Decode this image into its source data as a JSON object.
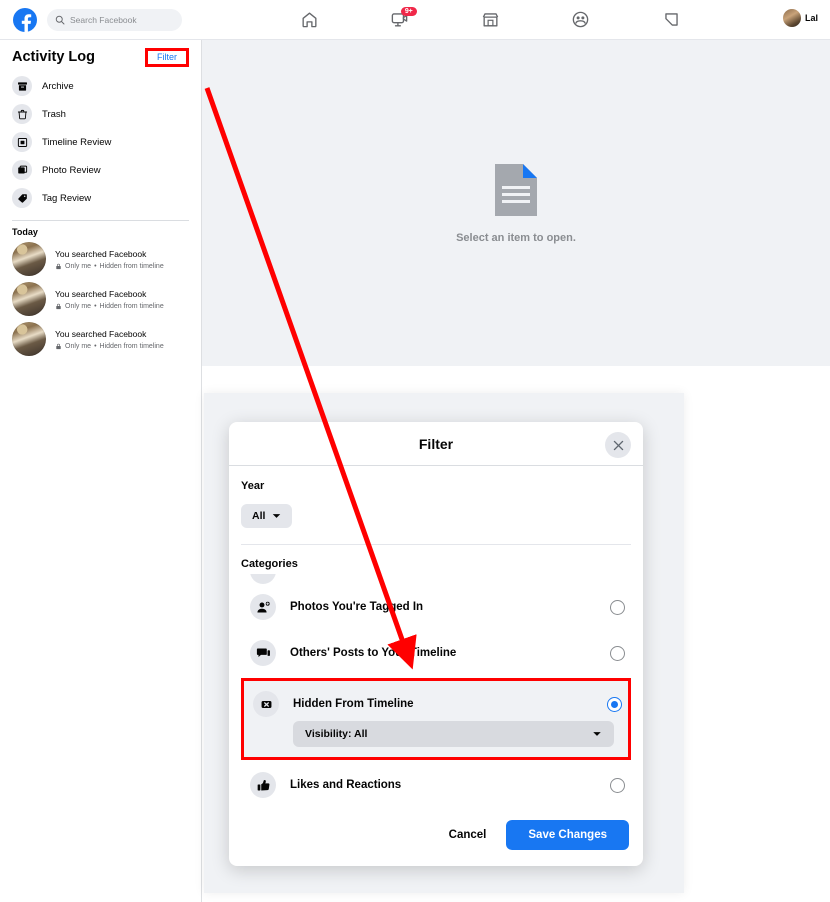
{
  "topbar": {
    "logo_icon": "facebook-logo-icon",
    "search": {
      "placeholder": "Search Facebook",
      "value": "",
      "icon": "search-icon"
    },
    "nav": [
      {
        "name": "home",
        "icon": "home-icon",
        "badge": ""
      },
      {
        "name": "watch",
        "icon": "video-watch-icon",
        "badge": "9+"
      },
      {
        "name": "marketplace",
        "icon": "marketplace-store-icon",
        "badge": ""
      },
      {
        "name": "groups",
        "icon": "groups-icon",
        "badge": ""
      },
      {
        "name": "gaming",
        "icon": "gaming-icon",
        "badge": ""
      }
    ],
    "profile": {
      "name": "Lal",
      "avatar_icon": "avatar"
    }
  },
  "sidebar": {
    "title": "Activity Log",
    "filter_label": "Filter",
    "items": [
      {
        "label": "Archive",
        "icon": "archive-box-icon"
      },
      {
        "label": "Trash",
        "icon": "trash-can-icon"
      },
      {
        "label": "Timeline Review",
        "icon": "timeline-review-icon"
      },
      {
        "label": "Photo Review",
        "icon": "photo-review-icon"
      },
      {
        "label": "Tag Review",
        "icon": "tag-icon"
      }
    ],
    "section_label": "Today",
    "activities": [
      {
        "title": "You searched Facebook",
        "privacy": "Only me",
        "separator": "•",
        "visibility": "Hidden from timeline",
        "lock_icon": "lock-icon"
      },
      {
        "title": "You searched Facebook",
        "privacy": "Only me",
        "separator": "•",
        "visibility": "Hidden from timeline",
        "lock_icon": "lock-icon"
      },
      {
        "title": "You searched Facebook",
        "privacy": "Only me",
        "separator": "•",
        "visibility": "Hidden from timeline",
        "lock_icon": "lock-icon"
      }
    ]
  },
  "main": {
    "empty_text": "Select an item to open.",
    "empty_icon": "document-icon"
  },
  "overlay": {
    "ghost_text": "Select an item to open."
  },
  "modal": {
    "title": "Filter",
    "close_icon": "close-x-icon",
    "year": {
      "label": "Year",
      "value": "All",
      "chevron_icon": "chevron-down-icon"
    },
    "categories_label": "Categories",
    "categories": [
      {
        "label": "Photos You're Tagged In",
        "icon": "person-tagged-icon",
        "selected": false,
        "highlighted": false
      },
      {
        "label": "Others' Posts to Your Timeline",
        "icon": "comment-bubble-icon",
        "selected": false,
        "highlighted": false
      },
      {
        "label": "Hidden From Timeline",
        "icon": "hidden-x-icon",
        "selected": true,
        "highlighted": true,
        "sub_select": {
          "value": "Visibility: All",
          "chevron_icon": "chevron-down-icon"
        }
      },
      {
        "label": "Likes and Reactions",
        "icon": "thumbs-up-icon",
        "selected": false,
        "highlighted": false
      }
    ],
    "cancel_label": "Cancel",
    "save_label": "Save Changes"
  },
  "annotation": {
    "color": "#ff0000",
    "arrow_from": "filter-link",
    "arrow_to": "photos-youre-tagged-in-row"
  },
  "colors": {
    "brand_blue": "#1877f2",
    "page_gray": "#f0f2f5",
    "annotation_red": "#ff0000",
    "text_primary": "#050505",
    "text_secondary": "#65676b"
  }
}
